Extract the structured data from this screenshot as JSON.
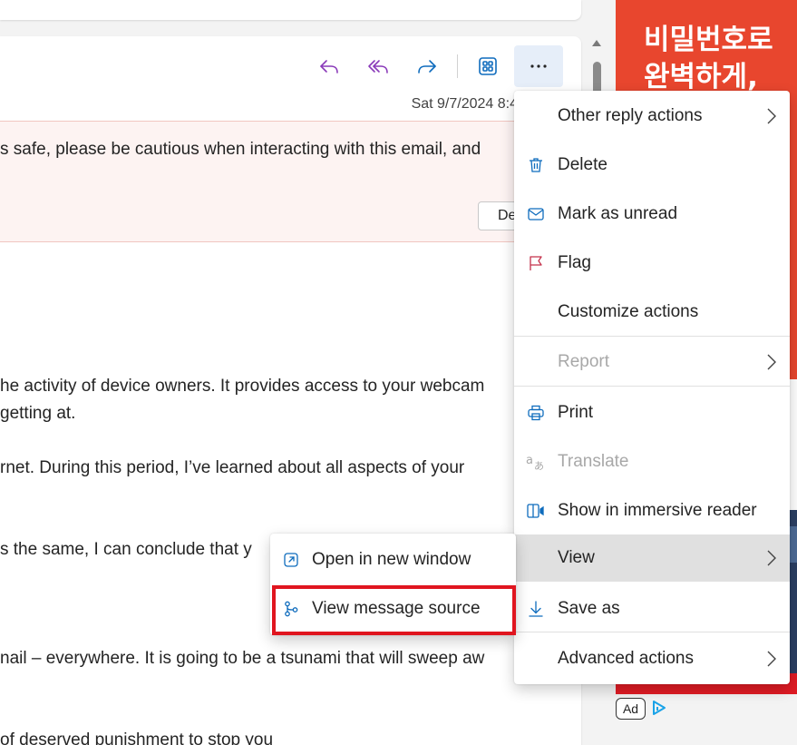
{
  "toolbar": {
    "reply_icon": "reply-icon",
    "reply_all_icon": "reply-all-icon",
    "forward_icon": "forward-icon",
    "apps_icon": "apps-icon",
    "more_label": "..."
  },
  "header": {
    "date": "Sat 9/7/2024 8:4"
  },
  "warning": {
    "text": "s safe, please be cautious when interacting with this email, and",
    "button_label": "De"
  },
  "body": {
    "lines": [
      "he activity of device owners. It provides access to your webcam",
      " getting at.",
      "rnet. During this period, I’ve learned about all aspects of your",
      "s the same, I can conclude that y",
      "nail – everywhere. It is going to be a tsunami that will sweep aw",
      "of deserved punishment to stop you"
    ]
  },
  "menu": {
    "items": [
      {
        "label": "Other reply actions",
        "icon": "",
        "has_submenu": true,
        "disabled": false
      },
      {
        "label": "Delete",
        "icon": "trash-icon",
        "has_submenu": false,
        "disabled": false
      },
      {
        "label": "Mark as unread",
        "icon": "envelope-icon",
        "has_submenu": false,
        "disabled": false
      },
      {
        "label": "Flag",
        "icon": "flag-icon",
        "has_submenu": false,
        "disabled": false
      },
      {
        "label": "Customize actions",
        "icon": "",
        "has_submenu": false,
        "disabled": false
      },
      {
        "label": "Report",
        "icon": "",
        "has_submenu": true,
        "disabled": true
      },
      {
        "label": "Print",
        "icon": "printer-icon",
        "has_submenu": false,
        "disabled": false
      },
      {
        "label": "Translate",
        "icon": "translate-icon",
        "has_submenu": false,
        "disabled": true
      },
      {
        "label": "Show in immersive reader",
        "icon": "immersive-reader-icon",
        "has_submenu": false,
        "disabled": false
      },
      {
        "label": "View",
        "icon": "",
        "has_submenu": true,
        "disabled": false
      },
      {
        "label": "Save as",
        "icon": "download-icon",
        "has_submenu": false,
        "disabled": false
      },
      {
        "label": "Advanced actions",
        "icon": "",
        "has_submenu": true,
        "disabled": false
      }
    ]
  },
  "submenu": {
    "items": [
      {
        "label": "Open in new window",
        "icon": "open-new-window-icon"
      },
      {
        "label": "View message source",
        "icon": "message-source-icon"
      }
    ]
  },
  "ad": {
    "headline_line1": "비밀번호로",
    "headline_line2": "완벽하게,",
    "badge": "Ad",
    "choice_icon": "adchoices-icon"
  },
  "colors": {
    "accent": "#0f6cbd",
    "toolbar_icon": "#8a3ab9",
    "menu_hover": "#e0e0e0",
    "highlight": "#e0151f",
    "ad_background": "#e8462e",
    "warning_background": "#fdf3f2"
  }
}
